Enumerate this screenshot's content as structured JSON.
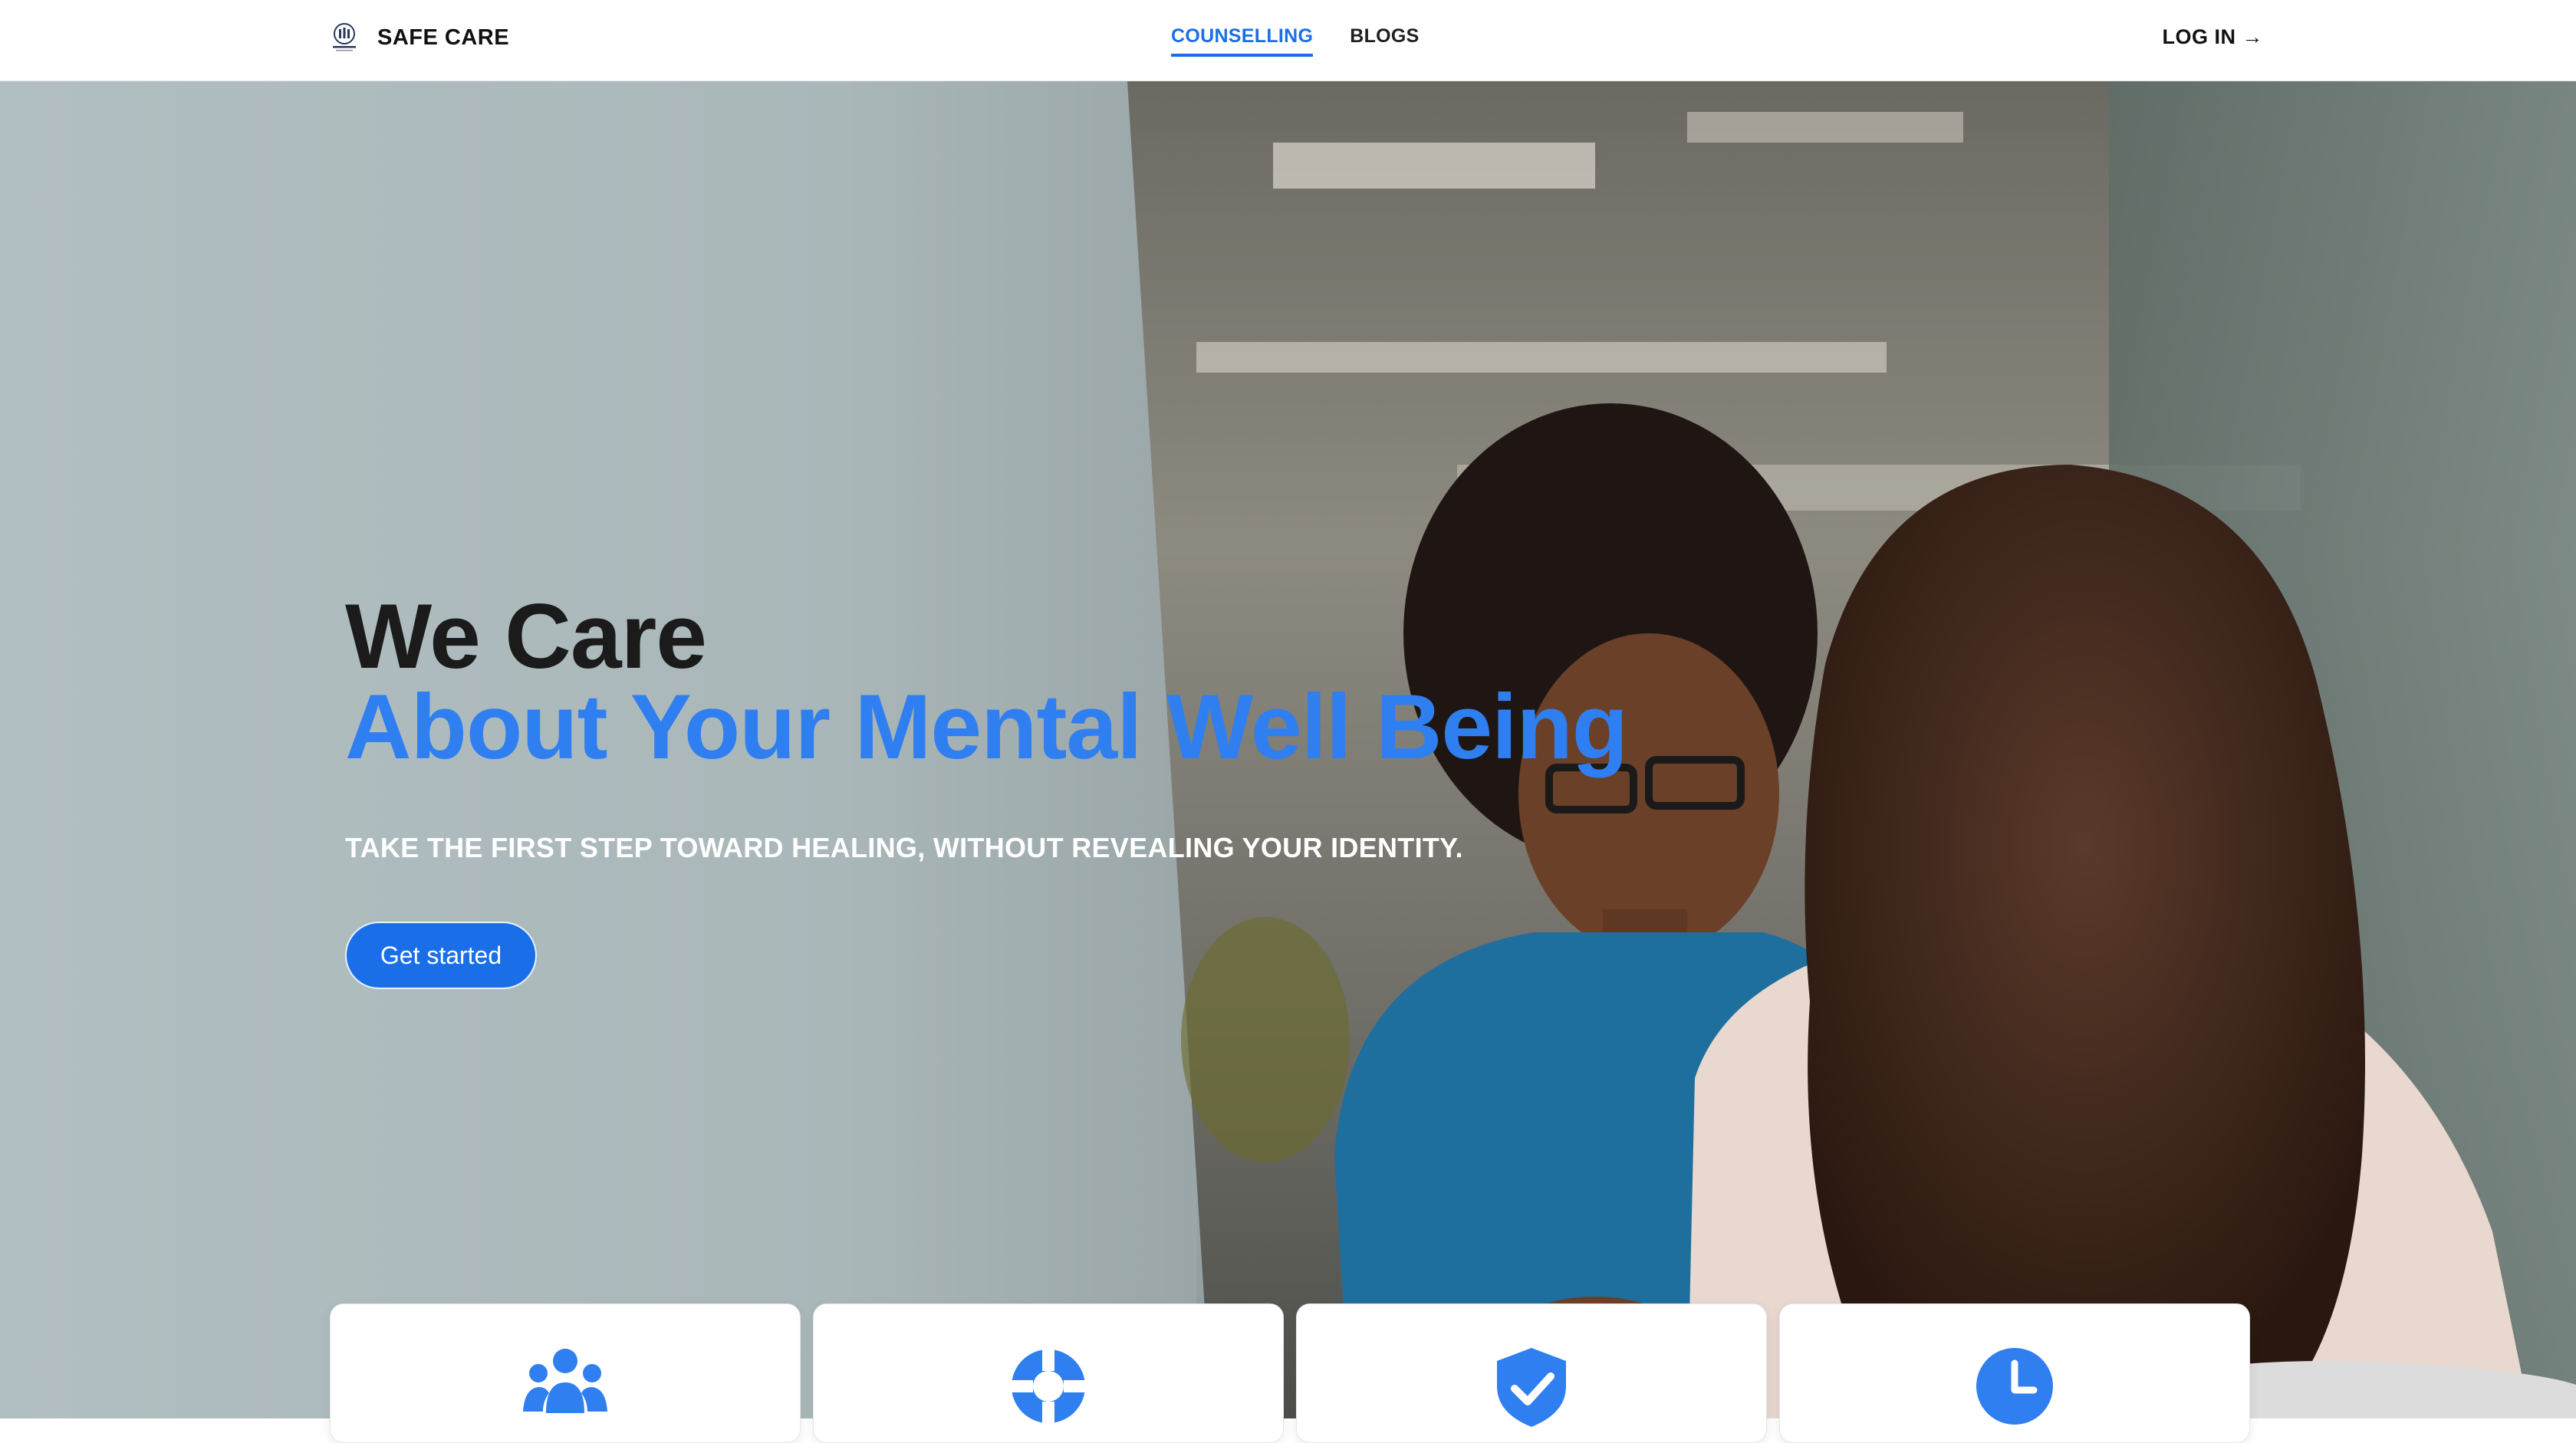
{
  "brand": {
    "name": "SAFE CARE",
    "logo": "safe-care-logo"
  },
  "nav": {
    "links": [
      {
        "label": "COUNSELLING",
        "active": true
      },
      {
        "label": "BLOGS",
        "active": false
      }
    ],
    "login": "LOG IN →"
  },
  "hero": {
    "title_line1": "We Care",
    "title_line2": "About Your Mental Well Being",
    "subtitle": "TAKE THE FIRST STEP TOWARD HEALING, WITHOUT REVEALING YOUR IDENTITY.",
    "cta": "Get started"
  },
  "features": [
    {
      "icon": "users-icon"
    },
    {
      "icon": "lifebuoy-icon"
    },
    {
      "icon": "shield-check-icon"
    },
    {
      "icon": "clock-icon"
    }
  ],
  "colors": {
    "accent": "#1a6fe8",
    "title_accent": "#2f7ff0",
    "text_dark": "#1b1b1b"
  }
}
